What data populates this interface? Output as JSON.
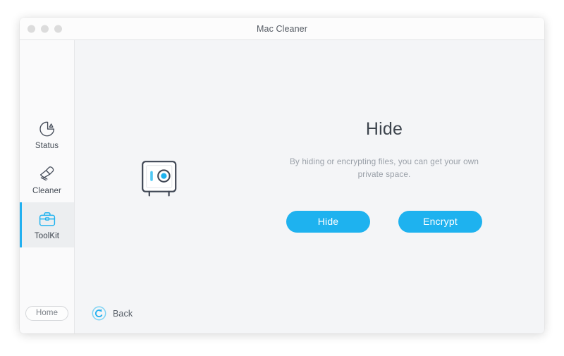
{
  "window": {
    "title": "Mac Cleaner",
    "traffic_lights": [
      "close-button",
      "minimize-button",
      "zoom-button"
    ]
  },
  "sidebar": {
    "items": [
      {
        "label": "Status",
        "icon": "pie-chart-icon",
        "active": false
      },
      {
        "label": "Cleaner",
        "icon": "brush-icon",
        "active": false
      },
      {
        "label": "ToolKit",
        "icon": "briefcase-icon",
        "active": true
      }
    ],
    "home_label": "Home"
  },
  "main": {
    "illustration_icon": "safe-vault-icon",
    "heading": "Hide",
    "description": "By hiding or encrypting files, you can get your own private space.",
    "buttons": [
      {
        "label": "Hide",
        "name": "hide-button"
      },
      {
        "label": "Encrypt",
        "name": "encrypt-button"
      }
    ],
    "back_label": "Back",
    "back_icon": "back-circle-arrow-icon"
  },
  "colors": {
    "accent": "#1eb2ef",
    "accent_light": "#4ec8f5",
    "icon_dark": "#454c59",
    "window_bg": "#f4f5f7",
    "sidebar_bg": "#fafafb",
    "titlebar_bg": "#fcfcfc",
    "active_item_bg": "#eceef0"
  }
}
